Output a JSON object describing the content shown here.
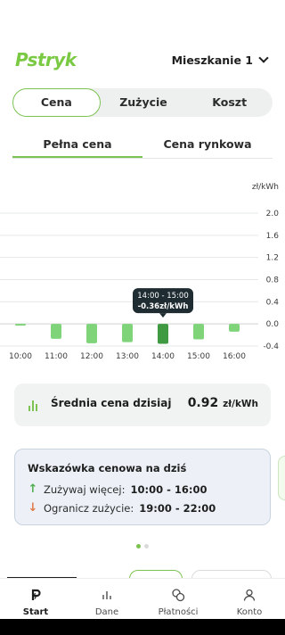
{
  "header": {
    "logo": "Pstryk",
    "apartment": "Mieszkanie 1"
  },
  "main_tabs": [
    {
      "label": "Cena",
      "active": true
    },
    {
      "label": "Zużycie",
      "active": false
    },
    {
      "label": "Koszt",
      "active": false
    }
  ],
  "sub_tabs": [
    {
      "label": "Pełna cena",
      "active": true
    },
    {
      "label": "Cena rynkowa",
      "active": false
    }
  ],
  "chart_data": {
    "type": "bar",
    "unit_label": "zł/kWh",
    "y_ticks": [
      "2.0",
      "1.6",
      "1.2",
      "0.8",
      "0.4",
      "0.0",
      "-0.4"
    ],
    "ylim": [
      -0.4,
      2.0
    ],
    "x_labels": [
      "10:00",
      "11:00",
      "12:00",
      "13:00",
      "14:00",
      "15:00",
      "16:00"
    ],
    "categories": [
      "10:00",
      "11:00",
      "12:00",
      "13:00",
      "14:00",
      "15:00",
      "16:00"
    ],
    "values": [
      -0.01,
      -0.27,
      -0.35,
      -0.33,
      -0.36,
      -0.28,
      -0.14
    ],
    "selected_index": 4,
    "colors": {
      "bar": "#7fd47a",
      "selected": "#3f9a42",
      "tooltip_bg": "#1f2d33"
    },
    "tooltip": {
      "time": "14:00 - 15:00",
      "value": "-0.36zł/kWh"
    }
  },
  "average": {
    "label": "Średnia cena dzisiaj",
    "value": "0.92",
    "unit": "zł/kWh",
    "icon": "bar-chart-icon"
  },
  "hint": {
    "title": "Wskazówka cenowa na dziś",
    "more_label": "Zużywaj więcej:",
    "more_value": "10:00 - 16:00",
    "less_label": "Ogranicz zużycie:",
    "less_value": "19:00 - 22:00",
    "colors": {
      "up": "#4cae50",
      "down": "#e07a4a"
    }
  },
  "pager": {
    "count": 2,
    "active": 0
  },
  "nav": [
    {
      "label": "Start",
      "icon": "home-icon",
      "active": true
    },
    {
      "label": "Dane",
      "icon": "bar-chart-icon",
      "active": false
    },
    {
      "label": "Płatności",
      "icon": "coins-icon",
      "active": false
    },
    {
      "label": "Konto",
      "icon": "user-icon",
      "active": false
    }
  ]
}
